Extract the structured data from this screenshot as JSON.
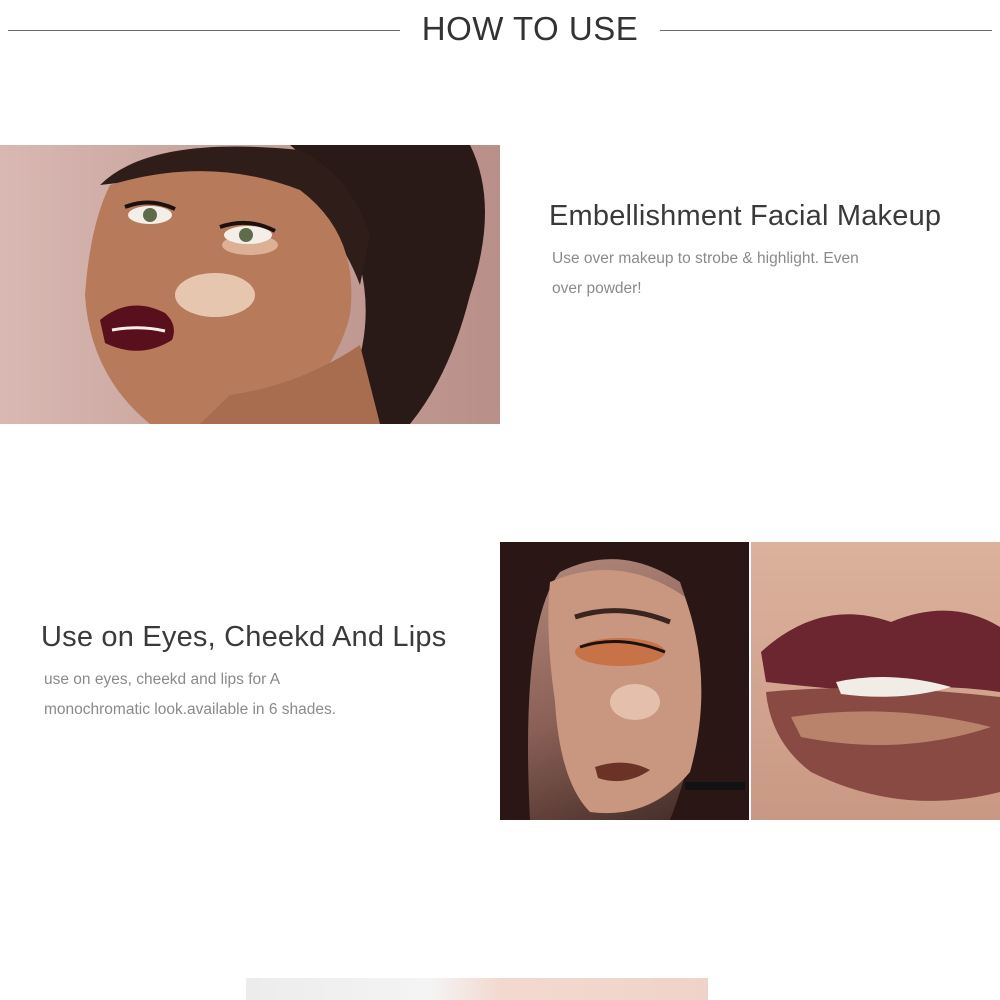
{
  "header": {
    "title": "HOW TO USE"
  },
  "blocks": [
    {
      "title": "Embellishment Facial Makeup",
      "desc_line1": "Use over makeup to strobe & highlight. Even",
      "desc_line2": "over powder!"
    },
    {
      "title": "Use on Eyes, Cheekd And Lips",
      "desc_line1": "use on eyes, cheekd and lips for A",
      "desc_line2": "monochromatic look.available in 6 shades."
    }
  ]
}
